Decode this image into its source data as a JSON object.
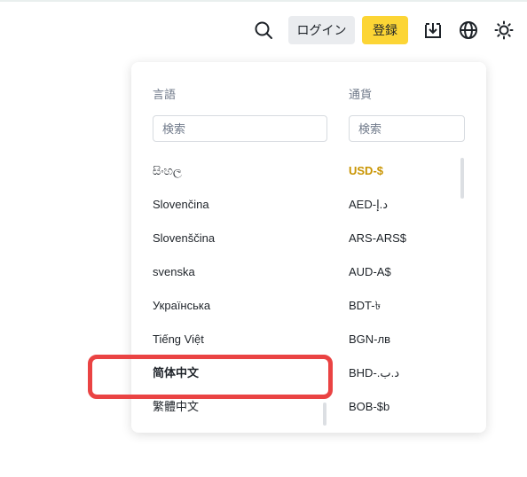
{
  "header": {
    "login_label": "ログイン",
    "register_label": "登録"
  },
  "dropdown": {
    "language": {
      "heading": "言語",
      "search_placeholder": "検索",
      "items": [
        "සිංහල",
        "Slovenčina",
        "Slovenščina",
        "svenska",
        "Українська",
        "Tiếng Việt",
        "简体中文",
        "繁體中文"
      ],
      "highlighted": "简体中文"
    },
    "currency": {
      "heading": "通貨",
      "search_placeholder": "検索",
      "selected": "USD-$",
      "items": [
        "USD-$",
        "AED-د.إ",
        "ARS-ARS$",
        "AUD-A$",
        "BDT-৳",
        "BGN-лв",
        "BHD-.د.ب",
        "BOB-$b"
      ]
    }
  },
  "colors": {
    "accent": "#fcd535",
    "selected_text": "#c99400",
    "highlight_box": "#ea4343"
  }
}
